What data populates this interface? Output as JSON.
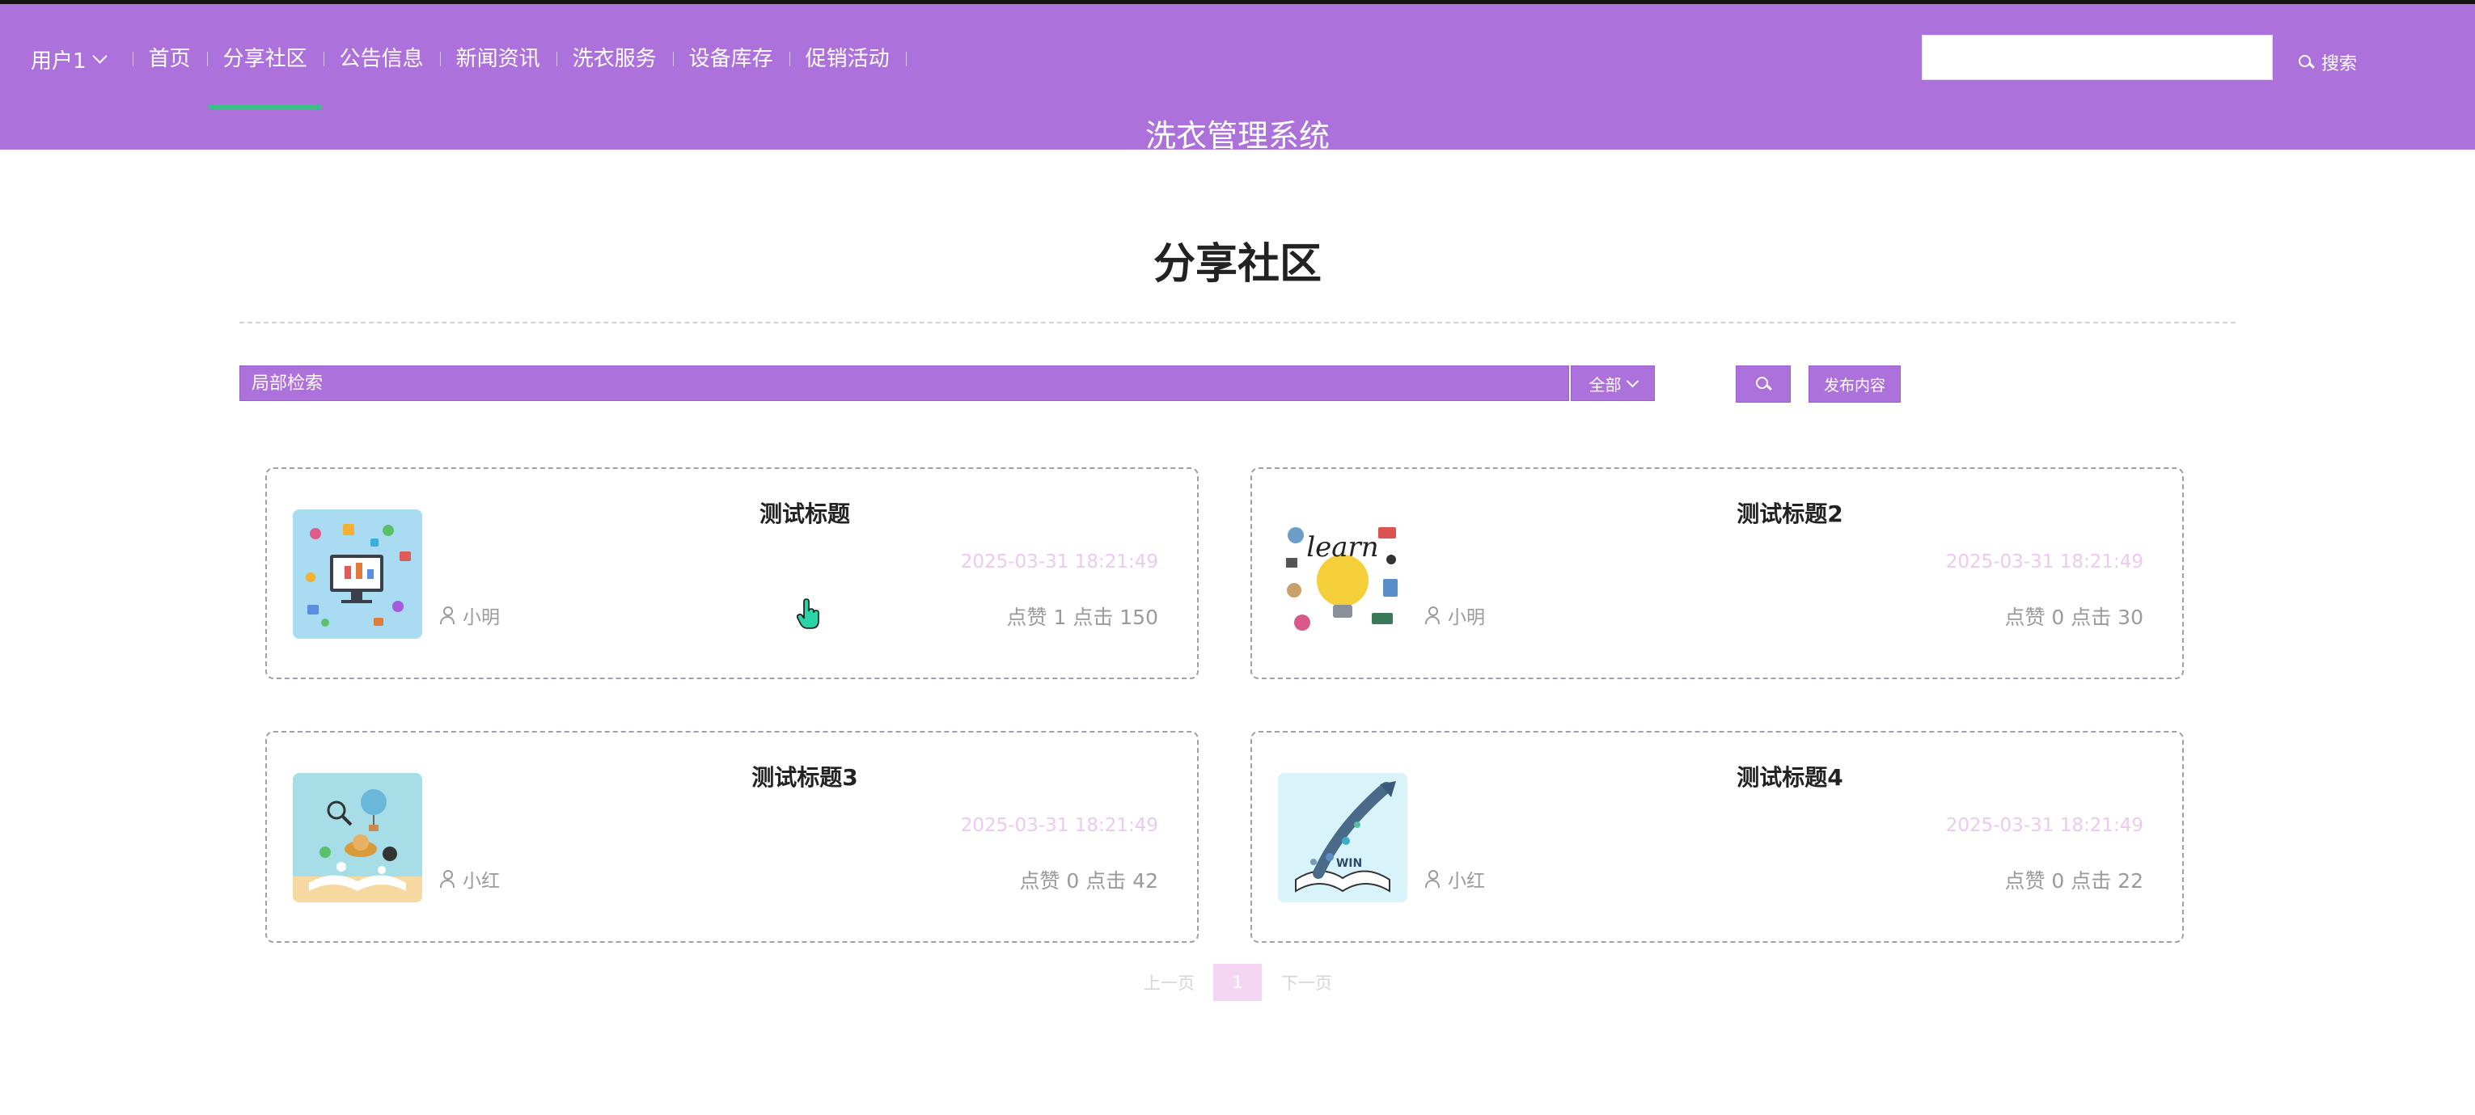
{
  "header": {
    "user_label": "用户1",
    "nav": [
      "首页",
      "分享社区",
      "公告信息",
      "新闻资讯",
      "洗衣服务",
      "设备库存",
      "促销活动"
    ],
    "active_nav": "分享社区",
    "search_value": "",
    "search_button": "搜索",
    "system_title": "洗衣管理系统",
    "accent_color": "#ad71dc",
    "active_underline_color": "#39c087"
  },
  "main": {
    "title": "分享社区",
    "filter": {
      "placeholder": "局部检索",
      "select_value": "全部",
      "publish_label": "发布内容"
    },
    "posts": [
      {
        "title": "测试标题",
        "time": "2025-03-31 18:21:49",
        "author": "小明",
        "stats": "点赞 1 点击 150",
        "image_icon": "social-media-illustration"
      },
      {
        "title": "测试标题2",
        "time": "2025-03-31 18:21:49",
        "author": "小明",
        "stats": "点赞 0 点击 30",
        "image_icon": "learn-lightbulb-illustration"
      },
      {
        "title": "测试标题3",
        "time": "2025-03-31 18:21:49",
        "author": "小红",
        "stats": "点赞 0 点击 42",
        "image_icon": "open-book-balloon-illustration"
      },
      {
        "title": "测试标题4",
        "time": "2025-03-31 18:21:49",
        "author": "小红",
        "stats": "点赞 0 点击 22",
        "image_icon": "open-book-rocket-illustration"
      }
    ],
    "pagination": {
      "prev": "上一页",
      "current": "1",
      "next": "下一页"
    }
  }
}
